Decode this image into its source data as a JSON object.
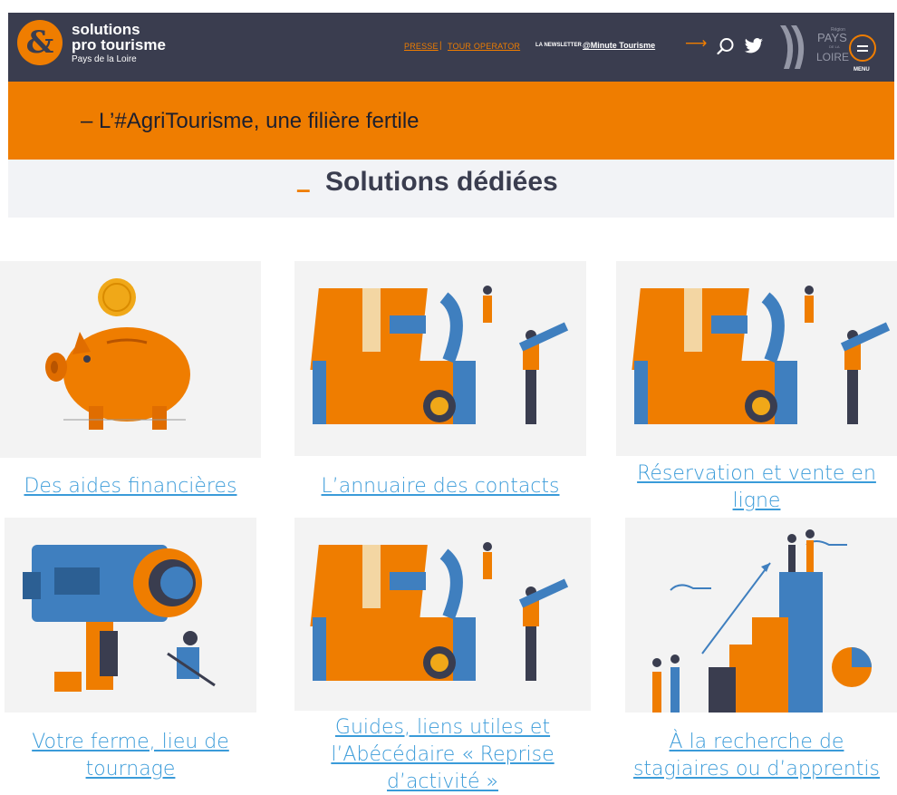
{
  "header": {
    "logo_symbol": "&",
    "logo_line1": "solutions",
    "logo_line2": "pro tourisme",
    "logo_line3": "Pays de la Loire",
    "nav_presse": "PRESSE",
    "nav_sep": "|",
    "nav_tour": "TOUR OPERATOR",
    "newsletter_pre": "LA NEWSLETTER",
    "newsletter": "@Minute Tourisme",
    "arrow": "⟶",
    "region_small": "Région",
    "region_pays": "PAYS",
    "region_de": "DE LA",
    "region_loire": "LOIRE",
    "menu_label": "MENU"
  },
  "banner": {
    "title": "– L’#AgriTourisme, une filière fertile"
  },
  "section": {
    "dash": "–",
    "title": "Solutions dédiées"
  },
  "cards": [
    {
      "label": "Des aides financières"
    },
    {
      "label": "L’annuaire des contacts"
    },
    {
      "label_line1": "Réservation et vente en",
      "label_line2": "ligne"
    },
    {
      "label_line1": "Votre ferme, lieu de",
      "label_line2": "tournage"
    },
    {
      "label_line1": "Guides, liens utiles et",
      "label_line2": "l’Abécédaire « Reprise",
      "label_line3": "d’activité »"
    },
    {
      "label_line1": "À la recherche de",
      "label_line2": "stagiaires ou d’apprentis"
    }
  ],
  "colors": {
    "orange": "#ef7d00",
    "navy": "#3a3d4f",
    "link": "#3a9bd9",
    "blue": "#3f7fbf"
  }
}
